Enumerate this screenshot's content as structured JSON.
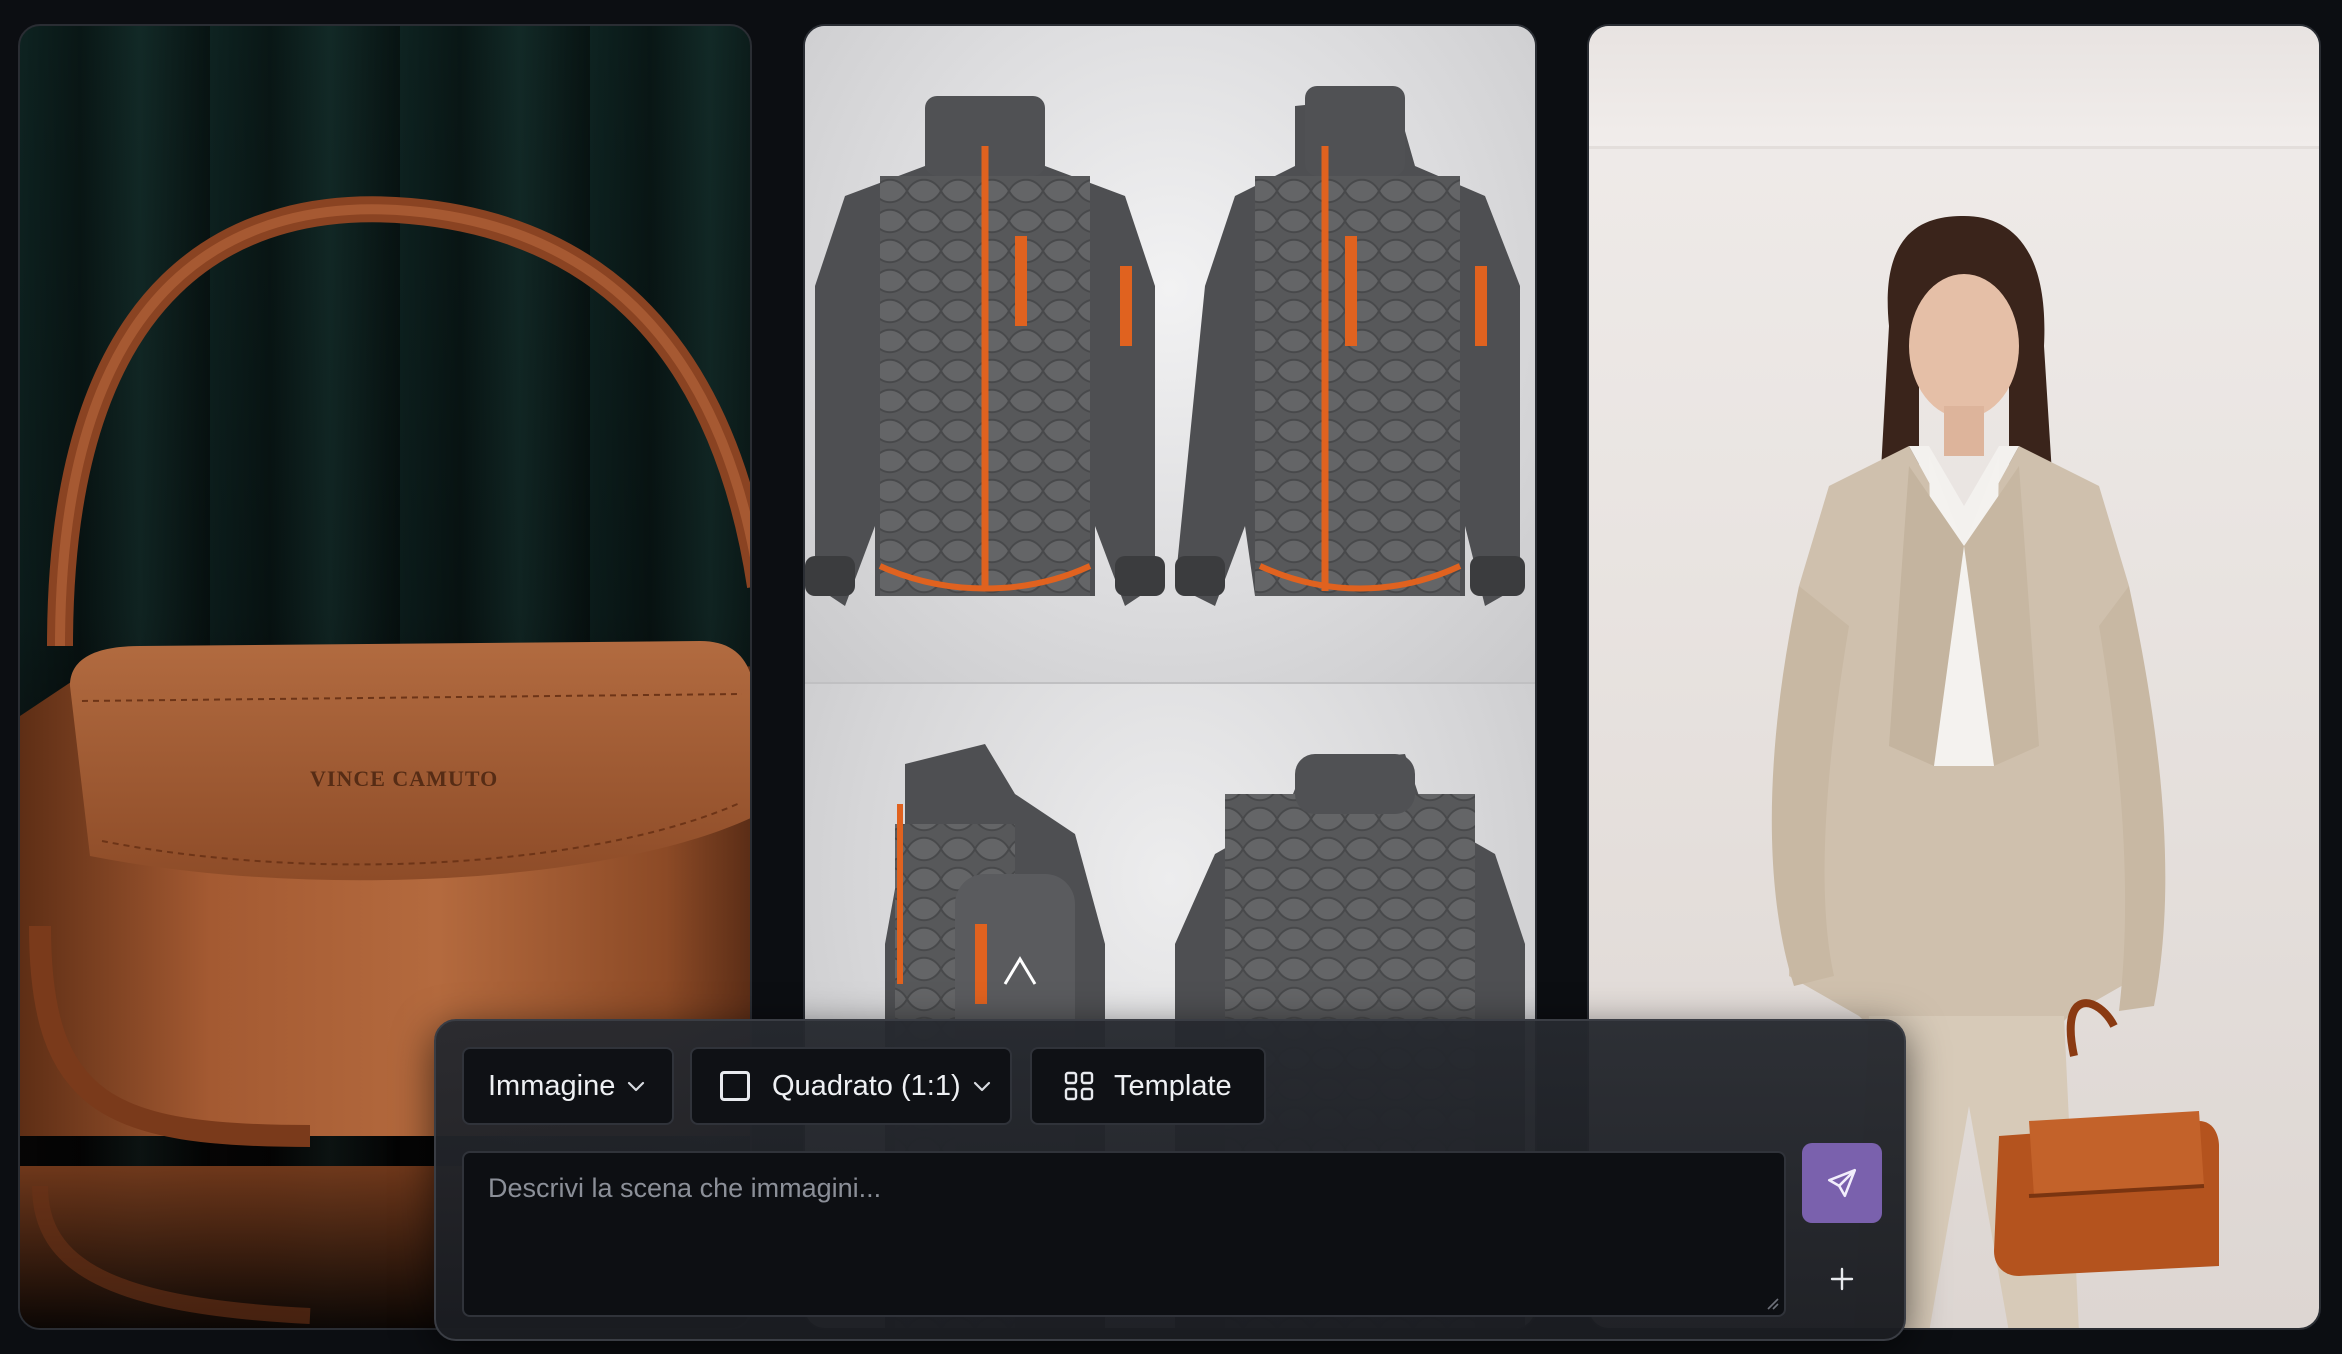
{
  "gallery": {
    "images": [
      {
        "subject": "leather handbag",
        "brand_text": "VINCE CAMUTO"
      },
      {
        "subject": "technical jacket four views"
      },
      {
        "subject": "model in beige suit with bag"
      }
    ]
  },
  "composer": {
    "type_select": {
      "label": "Immagine",
      "icon": "chevron-down-icon"
    },
    "ratio_select": {
      "label": "Quadrato (1:1)",
      "icon": "square-icon"
    },
    "template_button": {
      "label": "Template",
      "icon": "grid-icon"
    },
    "prompt": {
      "placeholder": "Descrivi la scena che immagini...",
      "value": ""
    },
    "send_button": {
      "icon": "send-icon"
    },
    "add_button": {
      "icon": "plus-icon"
    }
  },
  "colors": {
    "background": "#0c0e12",
    "composer_bg": "#1f2227",
    "accent": "#7a61ad",
    "text": "#eef0f3",
    "placeholder": "#8b8f98",
    "leather": "#9c5530",
    "jacket": "#5a5b5d",
    "jacket_trim": "#e0621f"
  }
}
